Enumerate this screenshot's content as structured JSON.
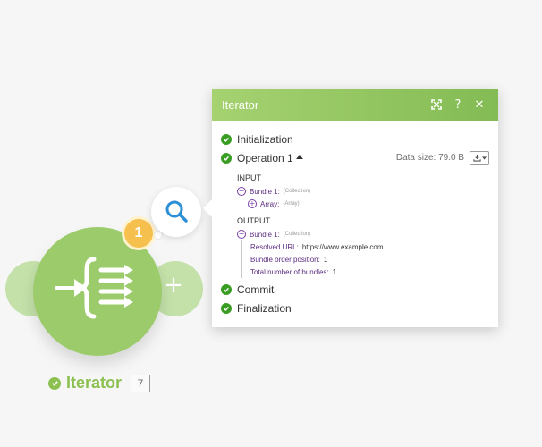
{
  "module": {
    "name": "Iterator",
    "number": "7",
    "badge_count": "1",
    "brand_color": "#9ccb6c"
  },
  "panel": {
    "title": "Iterator",
    "sections": {
      "initialization": "Initialization",
      "operation": "Operation 1",
      "commit": "Commit",
      "finalization": "Finalization"
    },
    "data_size": "Data size: 79.0 B",
    "input": {
      "label": "INPUT",
      "bundle_label": "Bundle 1:",
      "bundle_type": "(Collection)",
      "array_label": "Array:",
      "array_type": "(Array)"
    },
    "output": {
      "label": "OUTPUT",
      "bundle_label": "Bundle 1:",
      "bundle_type": "(Collection)",
      "fields": [
        {
          "key": "Resolved URL:",
          "value": "https://www.example.com"
        },
        {
          "key": "Bundle order position:",
          "value": "1"
        },
        {
          "key": "Total number of bundles:",
          "value": "1"
        }
      ]
    }
  }
}
